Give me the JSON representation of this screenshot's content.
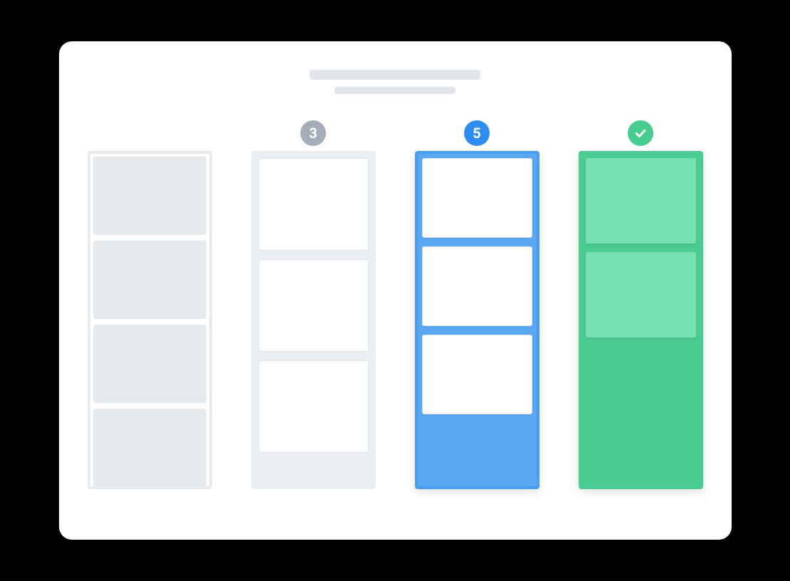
{
  "header": {
    "line1_width": 240,
    "line2_width": 170
  },
  "columns": [
    {
      "id": "col-1",
      "badge": null,
      "style": "outline-gray",
      "card_count": 4
    },
    {
      "id": "col-2",
      "badge": {
        "type": "number",
        "value": "3",
        "color": "gray"
      },
      "style": "fill-lightgray",
      "card_count": 3
    },
    {
      "id": "col-3",
      "badge": {
        "type": "number",
        "value": "5",
        "color": "blue"
      },
      "style": "fill-blue",
      "card_count": 3
    },
    {
      "id": "col-4",
      "badge": {
        "type": "check",
        "value": "",
        "color": "green"
      },
      "style": "fill-green",
      "card_count": 2
    }
  ],
  "colors": {
    "gray": "#a5adba",
    "blue": "#2d8cf0",
    "green": "#47cc90",
    "card_green": "#76dfb3",
    "placeholder": "#e2e6ea"
  }
}
